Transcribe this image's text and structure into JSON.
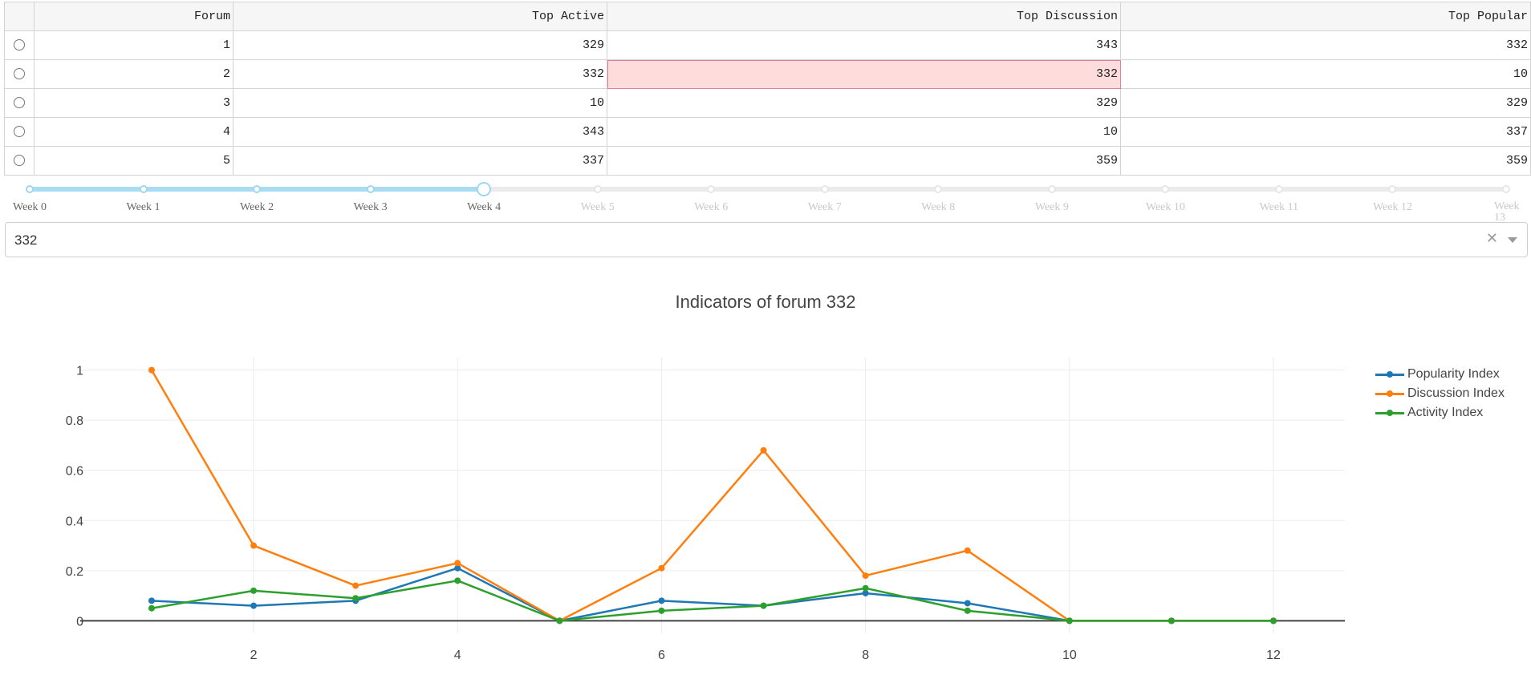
{
  "table": {
    "columns": [
      "Forum",
      "Top Active",
      "Top Discussion",
      "Top Popular"
    ],
    "rows": [
      [
        "1",
        "329",
        "343",
        "332"
      ],
      [
        "2",
        "332",
        "332",
        "10"
      ],
      [
        "3",
        "10",
        "329",
        "329"
      ],
      [
        "4",
        "343",
        "10",
        "337"
      ],
      [
        "5",
        "337",
        "359",
        "359"
      ]
    ]
  },
  "slider": {
    "marks": [
      "Week 0",
      "Week 1",
      "Week 2",
      "Week 3",
      "Week 4",
      "Week 5",
      "Week 6",
      "Week 7",
      "Week 8",
      "Week 9",
      "Week 10",
      "Week 11",
      "Week 12",
      "Week 13"
    ],
    "value_index": 4
  },
  "dropdown": {
    "value": "332",
    "clear_icon": "close-icon",
    "arrow_icon": "caret-down-icon"
  },
  "chart_data": {
    "type": "line",
    "title": "Indicators of forum 332",
    "xlabel": "",
    "ylabel": "",
    "xlim": [
      0.3,
      12.7
    ],
    "ylim": [
      -0.05,
      1.05
    ],
    "x_ticks": [
      2,
      4,
      6,
      8,
      10,
      12
    ],
    "y_ticks": [
      0,
      0.2,
      0.4,
      0.6,
      0.8,
      1
    ],
    "y_tick_labels": [
      "0",
      "0.2",
      "0.4",
      "0.6",
      "0.8",
      "1"
    ],
    "grid": true,
    "legend_position": "top-right",
    "x": [
      1,
      2,
      3,
      4,
      5,
      6,
      7,
      8,
      9,
      10,
      11,
      12
    ],
    "series": [
      {
        "name": "Popularity Index",
        "color": "#1f77b4",
        "values": [
          0.08,
          0.06,
          0.08,
          0.21,
          0,
          0.08,
          0.06,
          0.11,
          0.07,
          0,
          0,
          0
        ]
      },
      {
        "name": "Discussion Index",
        "color": "#ff7f0e",
        "values": [
          1,
          0.3,
          0.14,
          0.23,
          0,
          0.21,
          0.68,
          0.18,
          0.28,
          0,
          0,
          0
        ]
      },
      {
        "name": "Activity Index",
        "color": "#2ca02c",
        "values": [
          0.05,
          0.12,
          0.09,
          0.16,
          0,
          0.04,
          0.06,
          0.13,
          0.04,
          0,
          0,
          0
        ]
      }
    ]
  }
}
